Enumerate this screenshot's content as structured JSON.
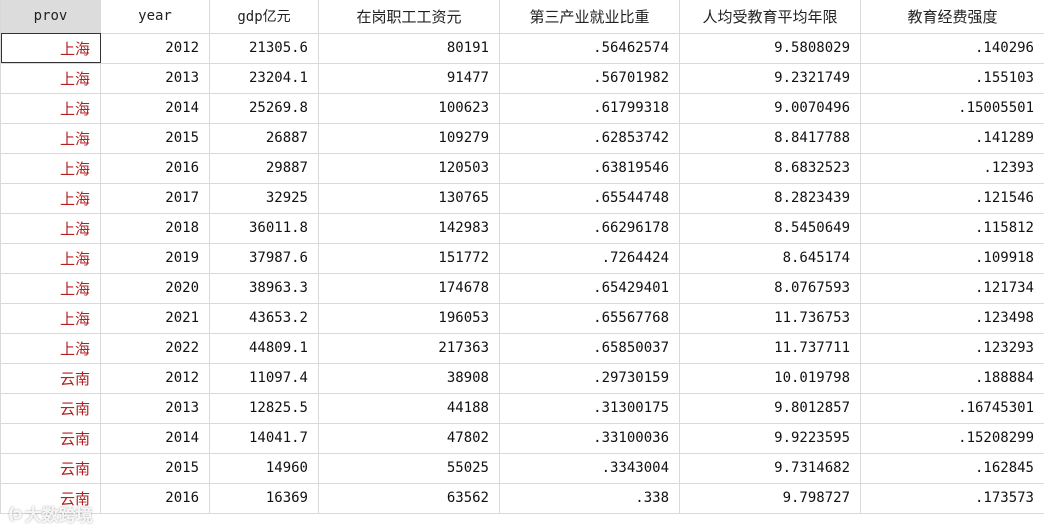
{
  "columns": [
    {
      "key": "prov",
      "label": "prov"
    },
    {
      "key": "year",
      "label": "year"
    },
    {
      "key": "gdp",
      "label": "gdp亿元"
    },
    {
      "key": "wage",
      "label": "在岗职工工资元"
    },
    {
      "key": "tertiary",
      "label": "第三产业就业比重"
    },
    {
      "key": "edu_years",
      "label": "人均受教育平均年限"
    },
    {
      "key": "edu_intensity",
      "label": "教育经费强度"
    }
  ],
  "rows": [
    [
      "上海",
      "2012",
      "21305.6",
      "80191",
      ".56462574",
      "9.5808029",
      ".140296"
    ],
    [
      "上海",
      "2013",
      "23204.1",
      "91477",
      ".56701982",
      "9.2321749",
      ".155103"
    ],
    [
      "上海",
      "2014",
      "25269.8",
      "100623",
      ".61799318",
      "9.0070496",
      ".15005501"
    ],
    [
      "上海",
      "2015",
      "26887",
      "109279",
      ".62853742",
      "8.8417788",
      ".141289"
    ],
    [
      "上海",
      "2016",
      "29887",
      "120503",
      ".63819546",
      "8.6832523",
      ".12393"
    ],
    [
      "上海",
      "2017",
      "32925",
      "130765",
      ".65544748",
      "8.2823439",
      ".121546"
    ],
    [
      "上海",
      "2018",
      "36011.8",
      "142983",
      ".66296178",
      "8.5450649",
      ".115812"
    ],
    [
      "上海",
      "2019",
      "37987.6",
      "151772",
      ".7264424",
      "8.645174",
      ".109918"
    ],
    [
      "上海",
      "2020",
      "38963.3",
      "174678",
      ".65429401",
      "8.0767593",
      ".121734"
    ],
    [
      "上海",
      "2021",
      "43653.2",
      "196053",
      ".65567768",
      "11.736753",
      ".123498"
    ],
    [
      "上海",
      "2022",
      "44809.1",
      "217363",
      ".65850037",
      "11.737711",
      ".123293"
    ],
    [
      "云南",
      "2012",
      "11097.4",
      "38908",
      ".29730159",
      "10.019798",
      ".188884"
    ],
    [
      "云南",
      "2013",
      "12825.5",
      "44188",
      ".31300175",
      "9.8012857",
      ".16745301"
    ],
    [
      "云南",
      "2014",
      "14041.7",
      "47802",
      ".33100036",
      "9.9223595",
      ".15208299"
    ],
    [
      "云南",
      "2015",
      "14960",
      "55025",
      ".3343004",
      "9.7314682",
      ".162845"
    ],
    [
      "云南",
      "2016",
      "16369",
      "63562",
      ".338",
      "9.798727",
      ".173573"
    ]
  ],
  "watermark": {
    "logo": "(ↄ",
    "text": "大数跨境"
  }
}
